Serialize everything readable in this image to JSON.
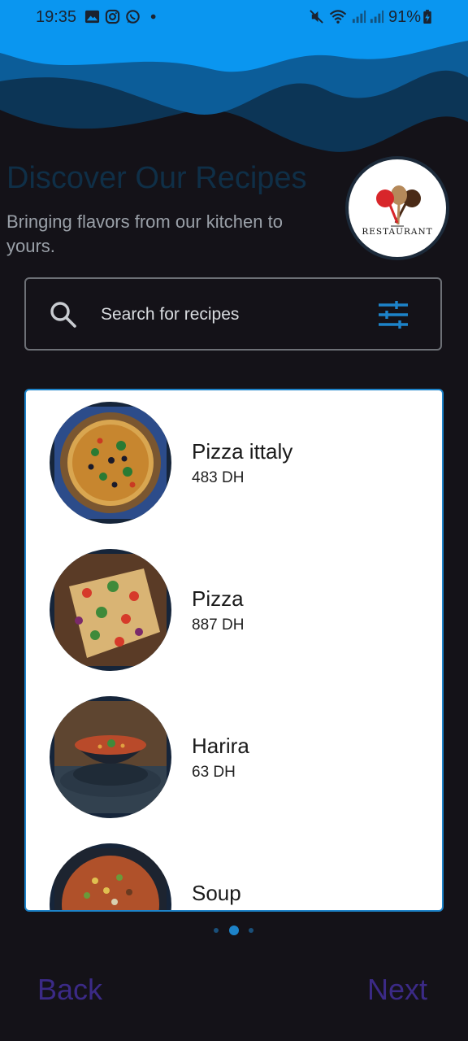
{
  "status_bar": {
    "time": "19:35",
    "battery": "91%",
    "left_icons": [
      "gallery-icon",
      "instagram-icon",
      "whatsapp-icon",
      "dot-icon"
    ],
    "right_icons": [
      "mute-icon",
      "wifi-icon",
      "signal-icon",
      "signal-icon",
      "battery-charging-icon"
    ]
  },
  "header": {
    "title": "Discover Our Recipes",
    "subtitle": "Bringing flavors from our kitchen to yours.",
    "logo_text": "RESTAURANT"
  },
  "search": {
    "placeholder": "Search for recipes",
    "search_icon": "search-icon",
    "filter_icon": "tune-icon"
  },
  "recipes": [
    {
      "name": "Pizza ittaly",
      "price": "483 DH"
    },
    {
      "name": "Pizza",
      "price": "887 DH"
    },
    {
      "name": "Harira",
      "price": "63 DH"
    },
    {
      "name": "Soup",
      "price": ""
    }
  ],
  "pager": {
    "count": 3,
    "active_index": 1
  },
  "nav": {
    "back_label": "Back",
    "next_label": "Next"
  },
  "colors": {
    "background": "#141218",
    "wave_light": "#0a96f0",
    "wave_mid": "#0c5d99",
    "wave_dark": "#0c3556",
    "accent": "#1d83c9",
    "nav_text": "#3b2a86"
  }
}
